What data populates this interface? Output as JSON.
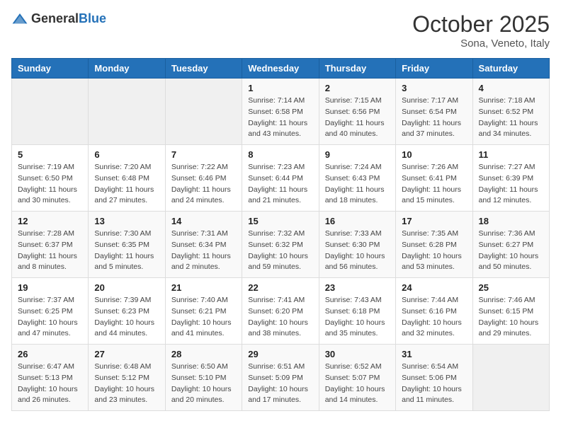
{
  "header": {
    "logo_general": "General",
    "logo_blue": "Blue",
    "month_title": "October 2025",
    "location": "Sona, Veneto, Italy"
  },
  "weekdays": [
    "Sunday",
    "Monday",
    "Tuesday",
    "Wednesday",
    "Thursday",
    "Friday",
    "Saturday"
  ],
  "weeks": [
    [
      null,
      null,
      null,
      {
        "day": "1",
        "sunrise": "Sunrise: 7:14 AM",
        "sunset": "Sunset: 6:58 PM",
        "daylight": "Daylight: 11 hours and 43 minutes."
      },
      {
        "day": "2",
        "sunrise": "Sunrise: 7:15 AM",
        "sunset": "Sunset: 6:56 PM",
        "daylight": "Daylight: 11 hours and 40 minutes."
      },
      {
        "day": "3",
        "sunrise": "Sunrise: 7:17 AM",
        "sunset": "Sunset: 6:54 PM",
        "daylight": "Daylight: 11 hours and 37 minutes."
      },
      {
        "day": "4",
        "sunrise": "Sunrise: 7:18 AM",
        "sunset": "Sunset: 6:52 PM",
        "daylight": "Daylight: 11 hours and 34 minutes."
      }
    ],
    [
      {
        "day": "5",
        "sunrise": "Sunrise: 7:19 AM",
        "sunset": "Sunset: 6:50 PM",
        "daylight": "Daylight: 11 hours and 30 minutes."
      },
      {
        "day": "6",
        "sunrise": "Sunrise: 7:20 AM",
        "sunset": "Sunset: 6:48 PM",
        "daylight": "Daylight: 11 hours and 27 minutes."
      },
      {
        "day": "7",
        "sunrise": "Sunrise: 7:22 AM",
        "sunset": "Sunset: 6:46 PM",
        "daylight": "Daylight: 11 hours and 24 minutes."
      },
      {
        "day": "8",
        "sunrise": "Sunrise: 7:23 AM",
        "sunset": "Sunset: 6:44 PM",
        "daylight": "Daylight: 11 hours and 21 minutes."
      },
      {
        "day": "9",
        "sunrise": "Sunrise: 7:24 AM",
        "sunset": "Sunset: 6:43 PM",
        "daylight": "Daylight: 11 hours and 18 minutes."
      },
      {
        "day": "10",
        "sunrise": "Sunrise: 7:26 AM",
        "sunset": "Sunset: 6:41 PM",
        "daylight": "Daylight: 11 hours and 15 minutes."
      },
      {
        "day": "11",
        "sunrise": "Sunrise: 7:27 AM",
        "sunset": "Sunset: 6:39 PM",
        "daylight": "Daylight: 11 hours and 12 minutes."
      }
    ],
    [
      {
        "day": "12",
        "sunrise": "Sunrise: 7:28 AM",
        "sunset": "Sunset: 6:37 PM",
        "daylight": "Daylight: 11 hours and 8 minutes."
      },
      {
        "day": "13",
        "sunrise": "Sunrise: 7:30 AM",
        "sunset": "Sunset: 6:35 PM",
        "daylight": "Daylight: 11 hours and 5 minutes."
      },
      {
        "day": "14",
        "sunrise": "Sunrise: 7:31 AM",
        "sunset": "Sunset: 6:34 PM",
        "daylight": "Daylight: 11 hours and 2 minutes."
      },
      {
        "day": "15",
        "sunrise": "Sunrise: 7:32 AM",
        "sunset": "Sunset: 6:32 PM",
        "daylight": "Daylight: 10 hours and 59 minutes."
      },
      {
        "day": "16",
        "sunrise": "Sunrise: 7:33 AM",
        "sunset": "Sunset: 6:30 PM",
        "daylight": "Daylight: 10 hours and 56 minutes."
      },
      {
        "day": "17",
        "sunrise": "Sunrise: 7:35 AM",
        "sunset": "Sunset: 6:28 PM",
        "daylight": "Daylight: 10 hours and 53 minutes."
      },
      {
        "day": "18",
        "sunrise": "Sunrise: 7:36 AM",
        "sunset": "Sunset: 6:27 PM",
        "daylight": "Daylight: 10 hours and 50 minutes."
      }
    ],
    [
      {
        "day": "19",
        "sunrise": "Sunrise: 7:37 AM",
        "sunset": "Sunset: 6:25 PM",
        "daylight": "Daylight: 10 hours and 47 minutes."
      },
      {
        "day": "20",
        "sunrise": "Sunrise: 7:39 AM",
        "sunset": "Sunset: 6:23 PM",
        "daylight": "Daylight: 10 hours and 44 minutes."
      },
      {
        "day": "21",
        "sunrise": "Sunrise: 7:40 AM",
        "sunset": "Sunset: 6:21 PM",
        "daylight": "Daylight: 10 hours and 41 minutes."
      },
      {
        "day": "22",
        "sunrise": "Sunrise: 7:41 AM",
        "sunset": "Sunset: 6:20 PM",
        "daylight": "Daylight: 10 hours and 38 minutes."
      },
      {
        "day": "23",
        "sunrise": "Sunrise: 7:43 AM",
        "sunset": "Sunset: 6:18 PM",
        "daylight": "Daylight: 10 hours and 35 minutes."
      },
      {
        "day": "24",
        "sunrise": "Sunrise: 7:44 AM",
        "sunset": "Sunset: 6:16 PM",
        "daylight": "Daylight: 10 hours and 32 minutes."
      },
      {
        "day": "25",
        "sunrise": "Sunrise: 7:46 AM",
        "sunset": "Sunset: 6:15 PM",
        "daylight": "Daylight: 10 hours and 29 minutes."
      }
    ],
    [
      {
        "day": "26",
        "sunrise": "Sunrise: 6:47 AM",
        "sunset": "Sunset: 5:13 PM",
        "daylight": "Daylight: 10 hours and 26 minutes."
      },
      {
        "day": "27",
        "sunrise": "Sunrise: 6:48 AM",
        "sunset": "Sunset: 5:12 PM",
        "daylight": "Daylight: 10 hours and 23 minutes."
      },
      {
        "day": "28",
        "sunrise": "Sunrise: 6:50 AM",
        "sunset": "Sunset: 5:10 PM",
        "daylight": "Daylight: 10 hours and 20 minutes."
      },
      {
        "day": "29",
        "sunrise": "Sunrise: 6:51 AM",
        "sunset": "Sunset: 5:09 PM",
        "daylight": "Daylight: 10 hours and 17 minutes."
      },
      {
        "day": "30",
        "sunrise": "Sunrise: 6:52 AM",
        "sunset": "Sunset: 5:07 PM",
        "daylight": "Daylight: 10 hours and 14 minutes."
      },
      {
        "day": "31",
        "sunrise": "Sunrise: 6:54 AM",
        "sunset": "Sunset: 5:06 PM",
        "daylight": "Daylight: 10 hours and 11 minutes."
      },
      null
    ]
  ]
}
